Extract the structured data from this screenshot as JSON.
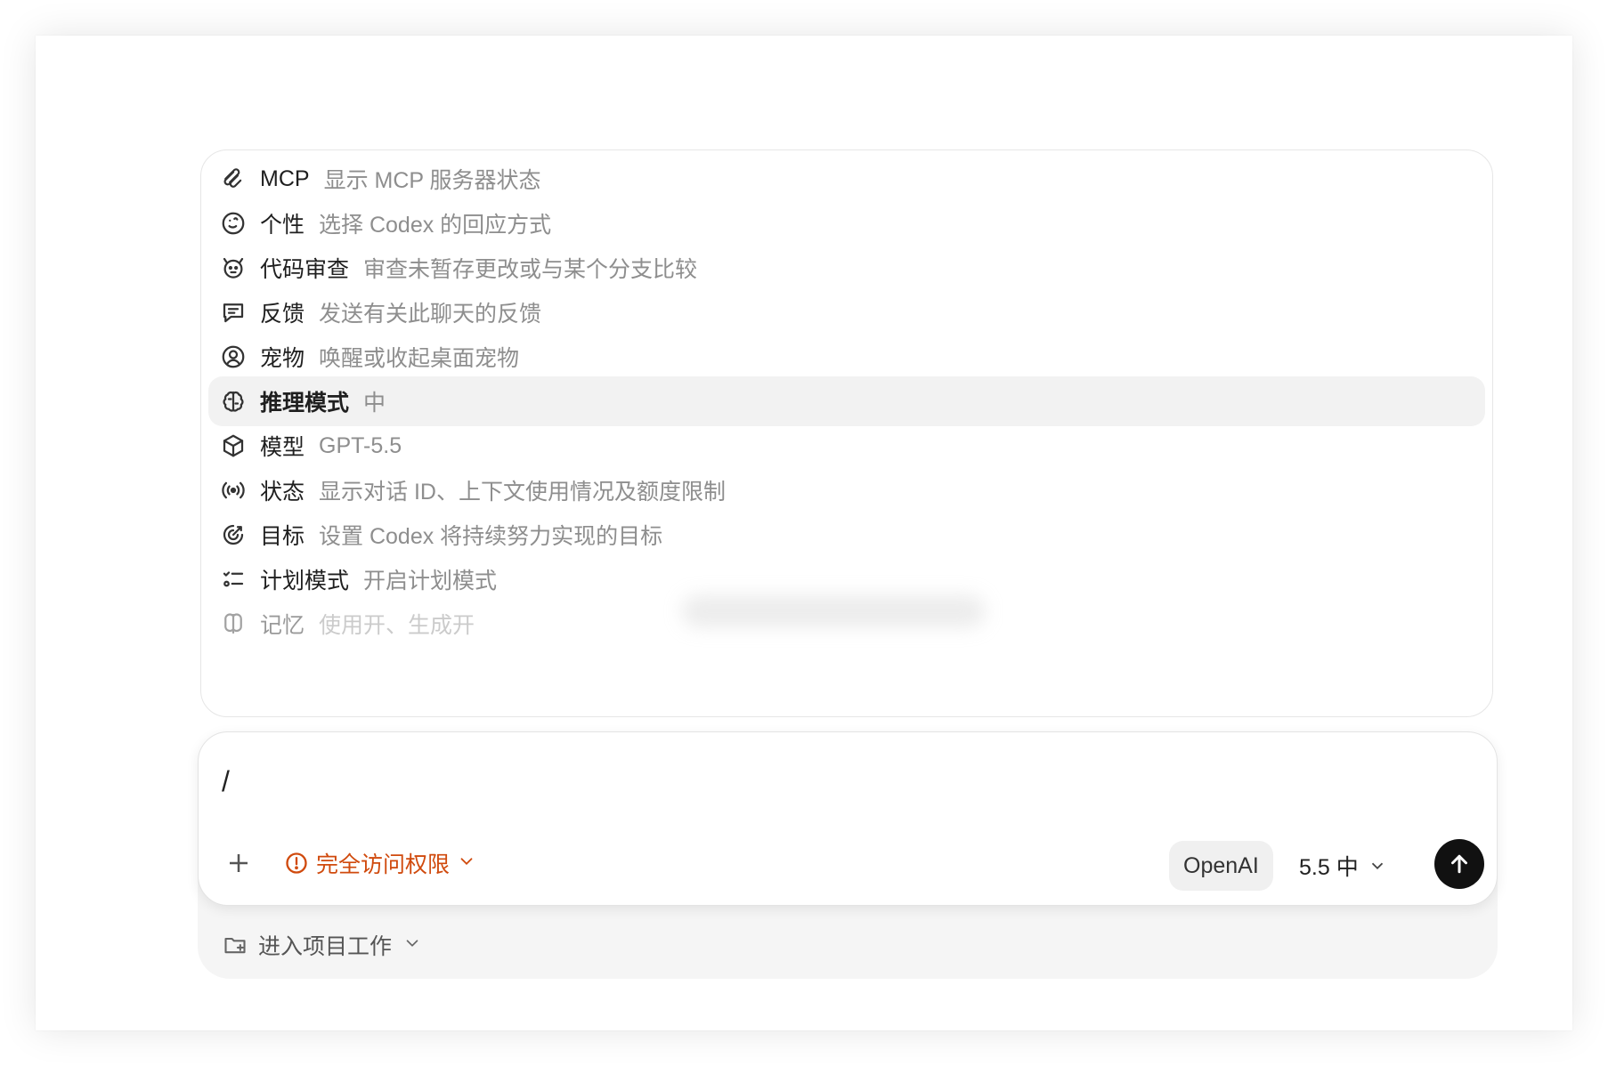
{
  "menu": {
    "items": [
      {
        "icon": "mcp-icon",
        "label": "MCP",
        "desc": "显示 MCP 服务器状态"
      },
      {
        "icon": "personality-icon",
        "label": "个性",
        "desc": "选择 Codex 的回应方式"
      },
      {
        "icon": "code-review-icon",
        "label": "代码审查",
        "desc": "审查未暂存更改或与某个分支比较"
      },
      {
        "icon": "feedback-icon",
        "label": "反馈",
        "desc": "发送有关此聊天的反馈"
      },
      {
        "icon": "pet-icon",
        "label": "宠物",
        "desc": "唤醒或收起桌面宠物"
      },
      {
        "icon": "brain-icon",
        "label": "推理模式",
        "desc": "中",
        "selected": true
      },
      {
        "icon": "cube-icon",
        "label": "模型",
        "desc": "GPT-5.5"
      },
      {
        "icon": "broadcast-icon",
        "label": "状态",
        "desc": "显示对话 ID、上下文使用情况及额度限制"
      },
      {
        "icon": "target-icon",
        "label": "目标",
        "desc": "设置 Codex 将持续努力实现的目标"
      },
      {
        "icon": "checklist-icon",
        "label": "计划模式",
        "desc": "开启计划模式"
      },
      {
        "icon": "memory-icon",
        "label": "记忆",
        "desc": "使用开、生成开"
      }
    ]
  },
  "composer": {
    "value": "/",
    "access_label": "完全访问权限",
    "provider_label": "OpenAI",
    "model_label": "5.5 中"
  },
  "footer": {
    "project_label": "进入项目工作"
  },
  "colors": {
    "warning": "#d04a0d",
    "send_bg": "#111111",
    "selected_bg": "#f2f2f2"
  }
}
